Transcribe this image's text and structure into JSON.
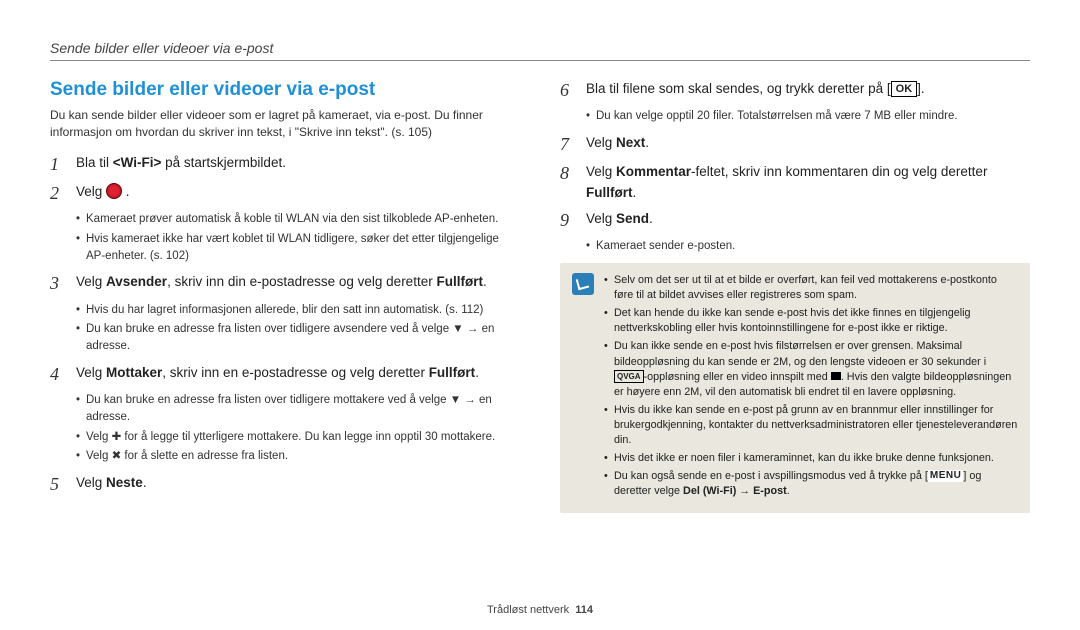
{
  "header": "Sende bilder eller videoer via e-post",
  "section_title": "Sende bilder eller videoer via e-post",
  "intro": "Du kan sende bilder eller videoer som er lagret på kameraet, via e-post. Du finner informasjon om hvordan du skriver inn tekst, i \"Skrive inn tekst\". (s. 105)",
  "left_steps": {
    "s1": {
      "num": "1",
      "pre": "Bla til ",
      "bold": "<Wi-Fi>",
      "post": " på startskjermbildet."
    },
    "s2": {
      "num": "2",
      "pre": "Velg ",
      "icon": "email-icon",
      "post": " ."
    },
    "s2_sub": [
      "Kameraet prøver automatisk å koble til WLAN via den sist tilkoblede AP-enheten.",
      "Hvis kameraet ikke har vært koblet til WLAN tidligere, søker det etter tilgjengelige AP-enheter. (s. 102)"
    ],
    "s3": {
      "num": "3",
      "t1": "Velg ",
      "b1": "Avsender",
      "t2": ", skriv inn din e-postadresse og velg deretter ",
      "b2": "Fullført",
      "t3": "."
    },
    "s3_sub": [
      "Hvis du har lagret informasjonen allerede, blir den satt inn automatisk. (s. 112)",
      "Du kan bruke en adresse fra listen over tidligere avsendere ved å velge ▼ → en adresse."
    ],
    "s4": {
      "num": "4",
      "t1": "Velg ",
      "b1": "Mottaker",
      "t2": ", skriv inn en e-postadresse og velg deretter ",
      "b2": "Fullført",
      "t3": "."
    },
    "s4_sub": [
      "Du kan bruke en adresse fra listen over tidligere mottakere ved å velge ▼ → en adresse.",
      "Velg ✚ for å legge til ytterligere mottakere. Du kan legge inn opptil 30 mottakere.",
      "Velg ✖ for å slette en adresse fra listen."
    ],
    "s5": {
      "num": "5",
      "t1": "Velg ",
      "b1": "Neste",
      "t2": "."
    }
  },
  "right_steps": {
    "s6": {
      "num": "6",
      "t1": "Bla til filene som skal sendes, og trykk deretter på [",
      "ok": "OK",
      "t2": "]."
    },
    "s6_sub": [
      "Du kan velge opptil 20 filer. Totalstørrelsen må være 7 MB eller mindre."
    ],
    "s7": {
      "num": "7",
      "t1": "Velg ",
      "b1": "Next",
      "t2": "."
    },
    "s8": {
      "num": "8",
      "t1": "Velg ",
      "b1": "Kommentar",
      "t2": "-feltet, skriv inn kommentaren din og velg deretter ",
      "b2": "Fullført",
      "t3": "."
    },
    "s9": {
      "num": "9",
      "t1": "Velg ",
      "b1": "Send",
      "t2": "."
    },
    "s9_sub": [
      "Kameraet sender e-posten."
    ]
  },
  "note_items": {
    "n1": "Selv om det ser ut til at et bilde er overført, kan feil ved mottakerens e-postkonto føre til at bildet avvises eller registreres som spam.",
    "n2": "Det kan hende du ikke kan sende e-post hvis det ikke finnes en tilgjengelig nettverkskobling eller hvis kontoinnstillingene for e-post ikke er riktige.",
    "n3a": "Du kan ikke sende en e-post hvis filstørrelsen er over grensen. Maksimal bildeoppløsning du kan sende er 2M, og den lengste videoen er 30 sekunder i ",
    "n3b": "-oppløsning eller en video innspilt med ",
    "n3c": ". Hvis den valgte bildeoppløsningen er høyere enn 2M, vil den automatisk bli endret til en lavere oppløsning.",
    "n4": "Hvis du ikke kan sende en e-post på grunn av en brannmur eller innstillinger for brukergodkjenning, kontakter du nettverksadministratoren eller tjenesteleverandøren din.",
    "n5": "Hvis det ikke er noen filer i kameraminnet, kan du ikke bruke denne funksjonen.",
    "n6a": "Du kan også sende en e-post i avspillingsmodus ved å trykke på [",
    "n6b": "MENU",
    "n6c": "] og deretter velge ",
    "n6d": "Del (Wi-Fi)",
    "n6e": " → ",
    "n6f": "E-post",
    "n6g": "."
  },
  "footer": {
    "label": "Trådløst nettverk",
    "page": "114"
  }
}
